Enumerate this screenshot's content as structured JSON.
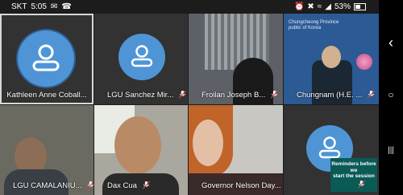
{
  "status_bar": {
    "carrier": "SKT",
    "time": "5:05",
    "battery": "53%",
    "battery_level": 0.53
  },
  "participants": [
    {
      "name": "Kathleen Anne Coball...",
      "muted": false,
      "active": true
    },
    {
      "name": "LGU Sanchez Mir...",
      "muted": true
    },
    {
      "name": "Froilan Joseph B...",
      "muted": true
    },
    {
      "name": "Chungnam (H.E. ...",
      "muted": true
    },
    {
      "name": "LGU CAMALANIU...",
      "muted": true
    },
    {
      "name": "Dax Cua",
      "muted": true
    },
    {
      "name": "Governor Nelson Day...",
      "muted": false
    },
    {
      "name": "",
      "muted": true
    }
  ],
  "tile4_banner": "Chungcheong Province\npublic of Korea",
  "overlay": {
    "line1": "Reminders before we",
    "line2": "start the session"
  },
  "nav": {
    "back": "‹",
    "home": "○",
    "recents": "|||"
  }
}
